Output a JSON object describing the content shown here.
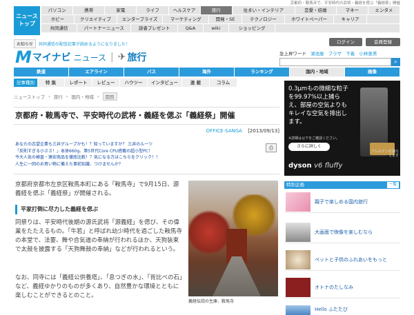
{
  "top_nav": {
    "news_top": "ニュース\nトップ",
    "rows": [
      [
        "パソコン",
        "携帯",
        "家電",
        "ライフ",
        "ヘルスケア",
        "旅行",
        "住まい・インテリア",
        "恋愛・結婚",
        "マネー",
        "エンタメ"
      ],
      [
        "ホビー",
        "クリエイティブ",
        "エンタープライズ",
        "マーケティング",
        "開発・SE",
        "テクノロジー",
        "ホワイトペーパー",
        "キャリア"
      ],
      [
        "共同通信",
        "パートナーニュース",
        "読者プレゼント",
        "Q&A",
        "wiki",
        "ショッピング"
      ]
    ],
    "active": "旅行",
    "breadcrumb_small": "京都府・鞍馬寺で、平安時代の武将・義経を偲ぶ「義経祭」開催"
  },
  "notice": {
    "tag": "お知らせ",
    "message": "共同通信の配信記事が読めるようになりました！"
  },
  "auth": {
    "login": "ログイン",
    "register": "会員登録"
  },
  "logo": {
    "mark": "M",
    "brand": "マイナビ",
    "brand2": "ニュース",
    "section": "旅行"
  },
  "quick_links": {
    "label": "急上昇ワード",
    "links": [
      "湖池屋",
      "ブラザ",
      "下着",
      "小林恵美"
    ]
  },
  "travel_nav": [
    "鉄道",
    "エアライン",
    "バス",
    "海外",
    "ランキング",
    "国内・地域",
    "画像"
  ],
  "travel_nav_active": "国内・地域",
  "sub_nav": {
    "first": "記事種別",
    "items": [
      "特 集",
      "レポート",
      "レビュー",
      "ハウツー",
      "インタビュー",
      "連 載",
      "コラム"
    ]
  },
  "crumbs": [
    "ニューストップ",
    "旅行",
    "国内・地域"
  ],
  "crumb_current": "関西",
  "article": {
    "title": "京都府・鞍馬寺で、平安時代の武将・義経を偲ぶ「義経祭」開催",
    "source": "OFFICE-SANGA",
    "date": "[2013/09/13]",
    "pr_links": [
      "あなたの志望企業も三井グループかも！？知っていますか？ 三井のルーツ",
      "「反則すぎる小ささ！」本体660g、第5世代Core CPU搭載の超小型PC！",
      "今大人気の検査・激安商品を徹底比較！？気になる方はこちらをクリック！！",
      "人生に一回のお買い物に備えた事前知識、つけませんか？"
    ],
    "lead": "京都府京都市左京区鞍馬本町にある「鞍馬寺」で9月15日、源義経を偲ぶ「義経祭」が開催される。",
    "subhead": "平家打倒に尽力した義経を偲ぶ",
    "body1": "同祭りは、平安時代後期の源氏武将「源義経」を偲び、その偉業をたたえるもの。「牛若」と呼ばれ幼少時代を過ごした鞍馬寺の本堂で、法要、舞や合気道の奉納が行われるほか、天狗装束で太鼓を披露する「天狗舞鼓の奉納」などが行われるという。",
    "body2": "なお、同寺には「義経公供養塔」、「息つぎの水」、「背比べの石」など、義経ゆかりのものが多くあり、自然豊かな環境とともに楽しむことができるとのこと。",
    "caption": "義経伝説の生庫、鞍馬寺"
  },
  "ad": {
    "text": "0.3μmもの微細な粒子を99.97%以上捕らえ、部屋の空気よりもキレイな空気を排出します。",
    "small": "※詳細は以下をご確認ください。",
    "button": "さらに詳しく",
    "note": "アレルゲンを捕らえます",
    "brand": "dyson",
    "model": "v6 fluffy"
  },
  "picks": {
    "header": "特別企画",
    "all": "一覧",
    "items": [
      "親子で楽しめる国内旅行",
      "大画面で映像を楽しむなら",
      "ペットと子供のふれあいをもっと",
      "オトナのたしなみ",
      "Hello ふたたび"
    ]
  }
}
